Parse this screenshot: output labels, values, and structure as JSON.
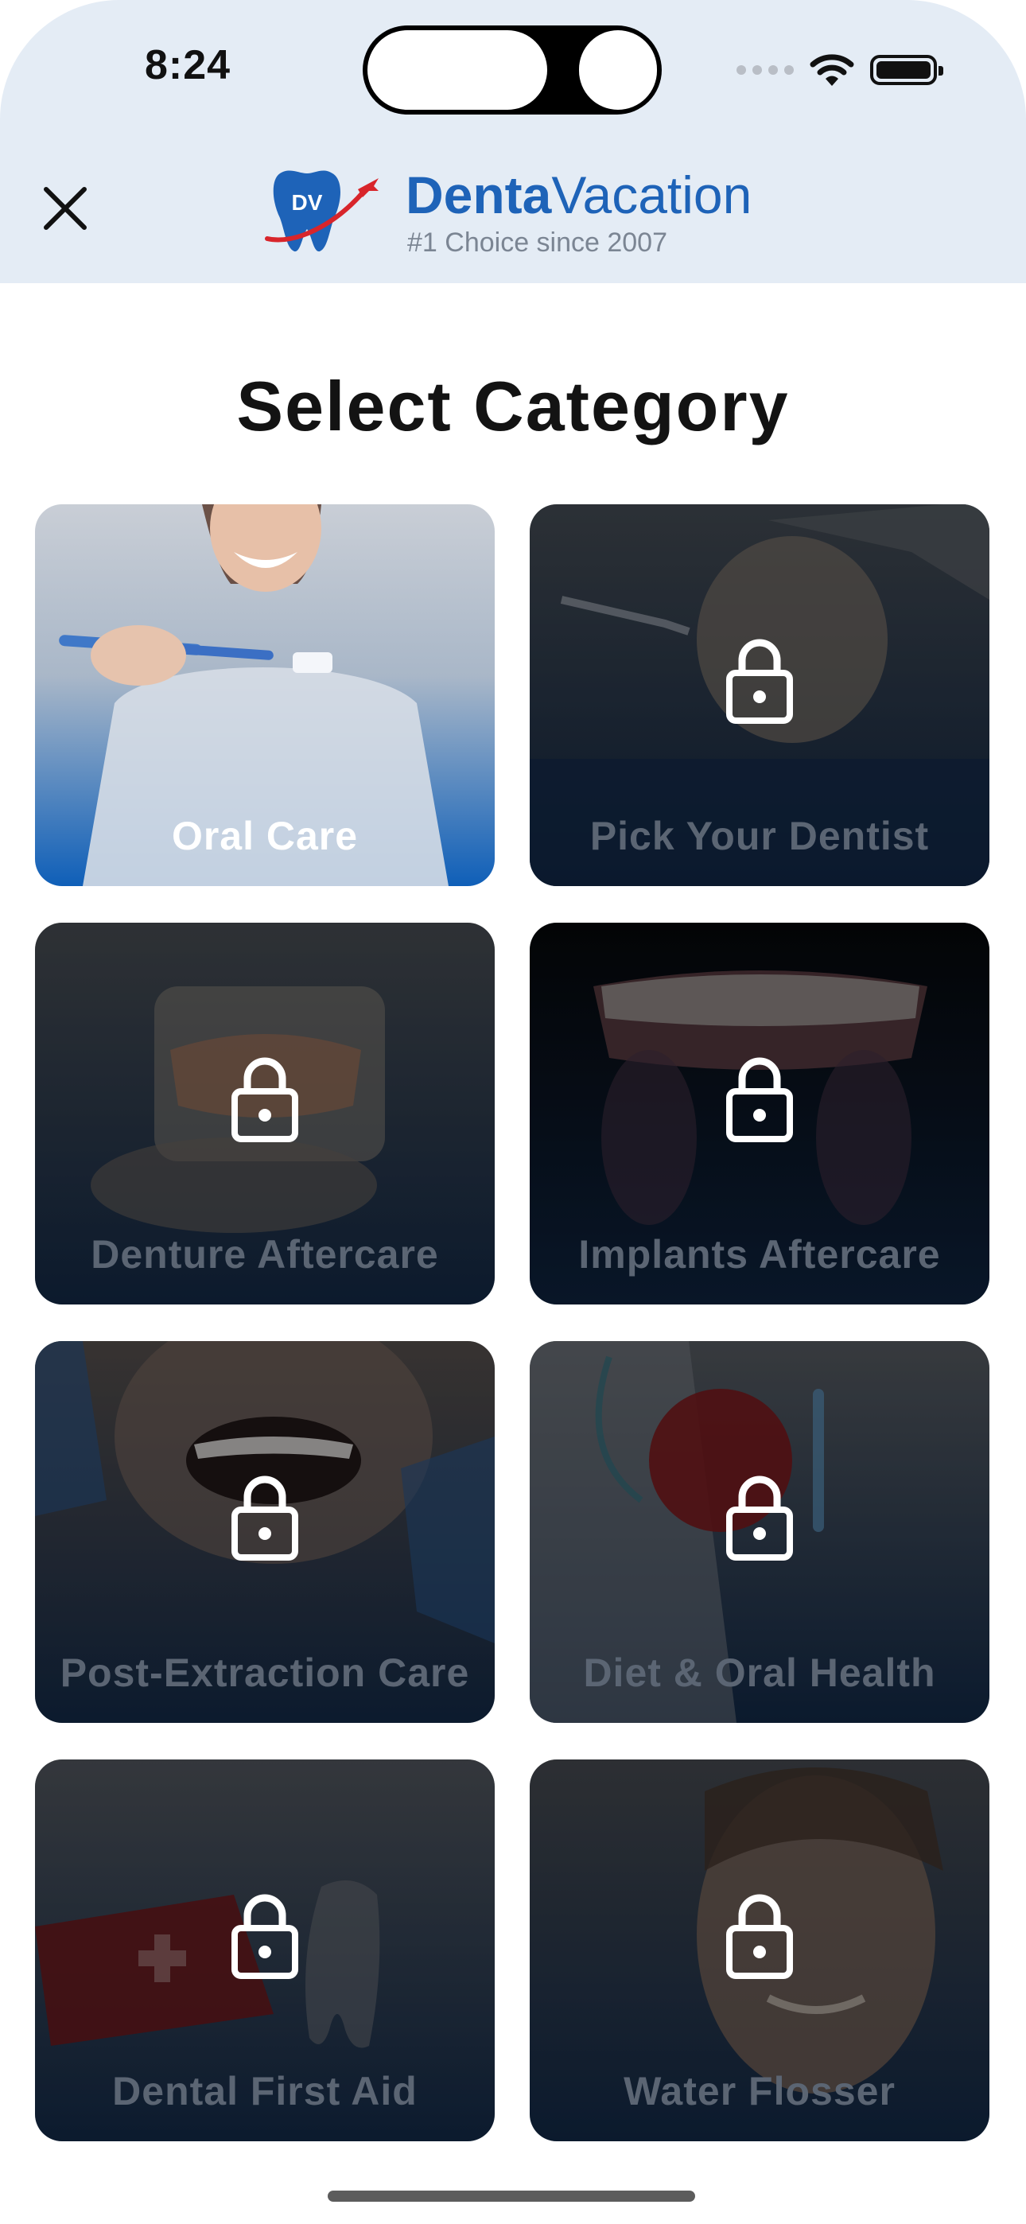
{
  "status_bar": {
    "time": "8:24"
  },
  "header": {
    "close_icon": "close-icon",
    "logo_initials": "DV",
    "brand_bold": "Denta",
    "brand_regular": "Vacation",
    "tagline": "#1 Choice since 2007"
  },
  "page": {
    "title": "Select Category"
  },
  "categories": [
    {
      "label": "Oral Care",
      "locked": false
    },
    {
      "label": "Pick Your Dentist",
      "locked": true
    },
    {
      "label": "Denture Aftercare",
      "locked": true
    },
    {
      "label": "Implants Aftercare",
      "locked": true
    },
    {
      "label": "Post-Extraction Care",
      "locked": true
    },
    {
      "label": "Diet & Oral Health",
      "locked": true
    },
    {
      "label": "Dental First Aid",
      "locked": true
    },
    {
      "label": "Water Flosser",
      "locked": true
    }
  ],
  "colors": {
    "brand_blue": "#1e63b8",
    "header_bg": "#e4ecf5",
    "locked_label": "#5b6573",
    "active_gradient_bottom": "#0f5fb8"
  }
}
